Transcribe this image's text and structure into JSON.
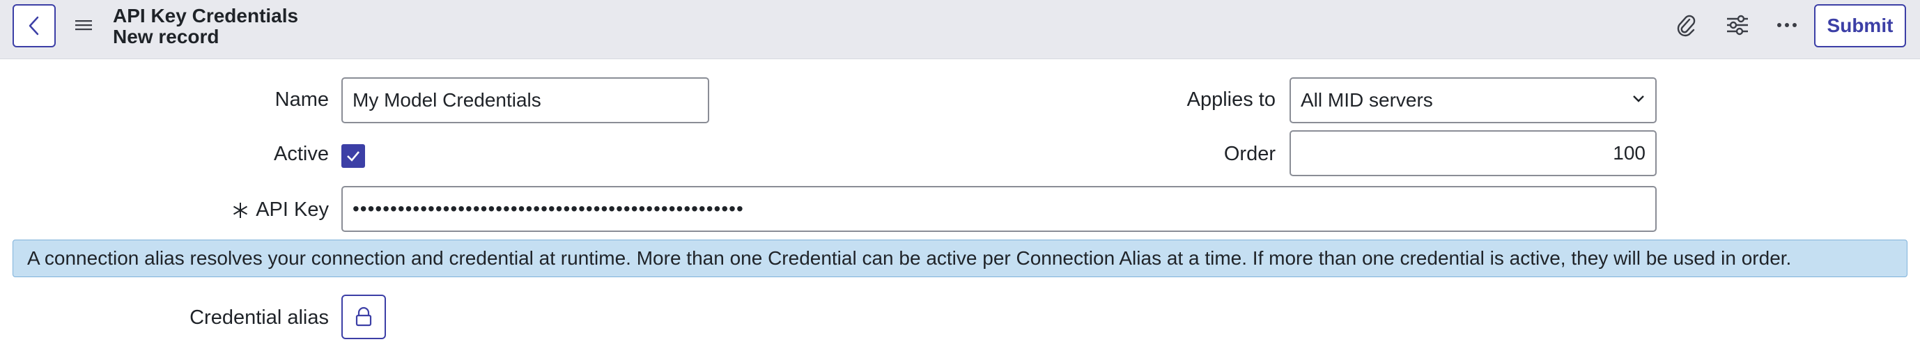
{
  "header": {
    "title": "API Key Credentials",
    "subtitle": "New record",
    "submit_label": "Submit"
  },
  "form": {
    "name_label": "Name",
    "name_value": "My Model Credentials",
    "applies_to_label": "Applies to",
    "applies_to_value": "All MID servers",
    "active_label": "Active",
    "active_checked": true,
    "order_label": "Order",
    "order_value": "100",
    "api_key_label": "API Key",
    "api_key_mask": "••••••••••••••••••••••••••••••••••••••••••••••••••••",
    "credential_alias_label": "Credential alias"
  },
  "info_message": "A connection alias resolves your connection and credential at runtime. More than one Credential can be active per Connection Alias at a time. If more than one credential is active, they will be used in order.",
  "colors": {
    "accent": "#3c3fa6",
    "header_bg": "#e8e9ee",
    "info_bg": "#c5dff2"
  },
  "icons": [
    "back-icon",
    "menu-icon",
    "paperclip-icon",
    "sliders-icon",
    "more-icon",
    "check-icon",
    "chevron-down-icon",
    "required-asterisk-icon",
    "lock-icon"
  ]
}
